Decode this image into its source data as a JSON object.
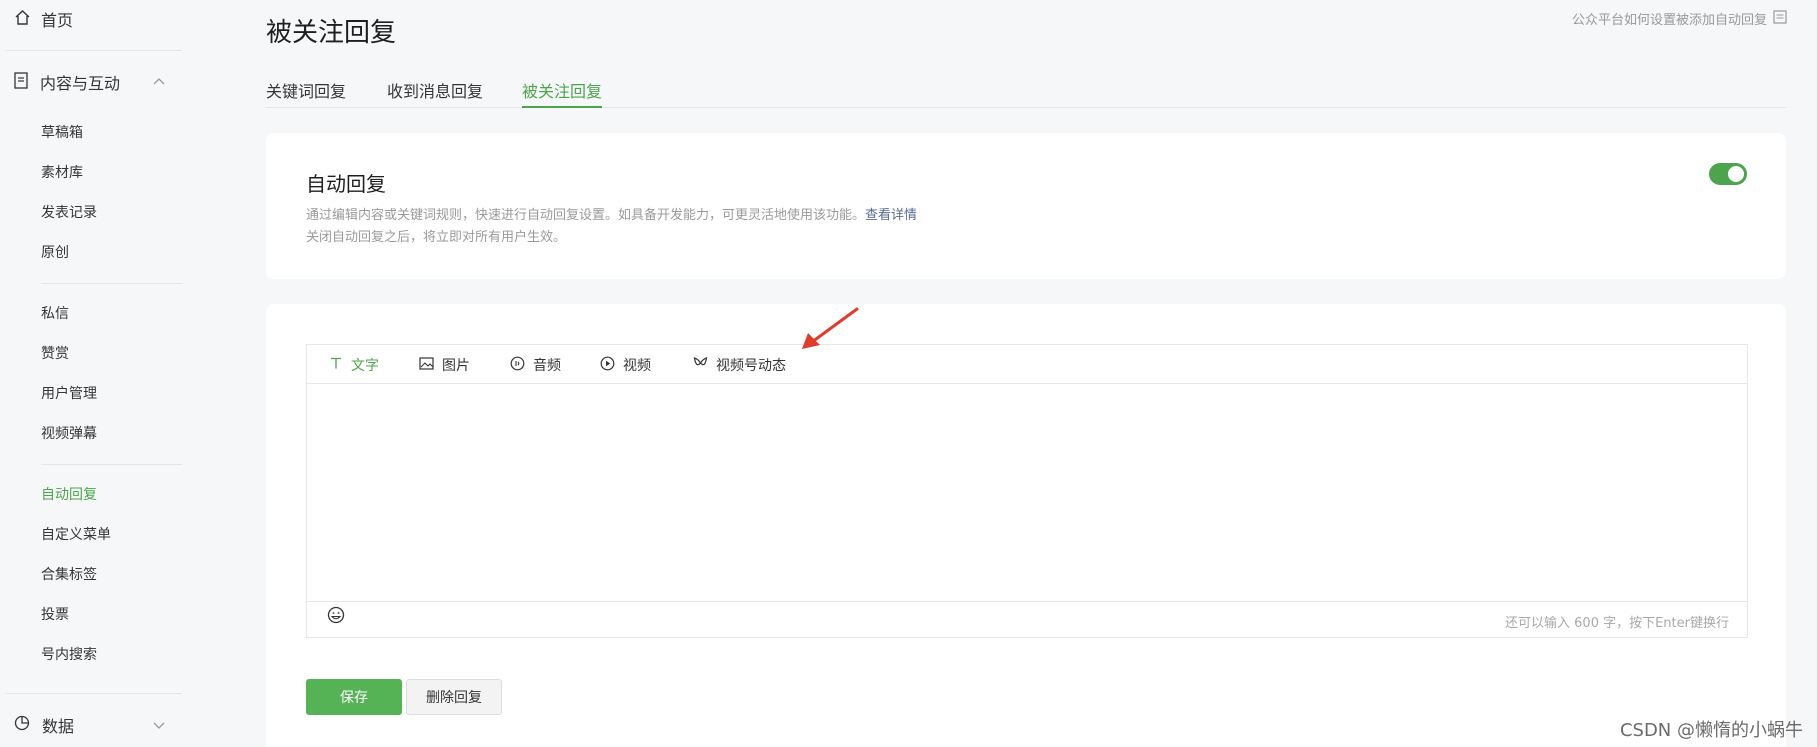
{
  "sidebar": {
    "home": "首页",
    "content_section": "内容与互动",
    "content_items": [
      "草稿箱",
      "素材库",
      "发表记录",
      "原创"
    ],
    "interaction_items": [
      "私信",
      "赞赏",
      "用户管理",
      "视频弹幕"
    ],
    "feature_items": [
      "自动回复",
      "自定义菜单",
      "合集标签",
      "投票",
      "号内搜索"
    ],
    "active_item": "自动回复",
    "data_section": "数据"
  },
  "header": {
    "title": "被关注回复",
    "help_link": "公众平台如何设置被添加自动回复"
  },
  "tabs": [
    {
      "label": "关键词回复",
      "active": false
    },
    {
      "label": "收到消息回复",
      "active": false
    },
    {
      "label": "被关注回复",
      "active": true
    }
  ],
  "auto_reply": {
    "title": "自动回复",
    "desc_line1": "通过编辑内容或关键词规则，快速进行自动回复设置。如具备开发能力，可更灵活地使用该功能。",
    "details_link": "查看详情",
    "desc_line2": "关闭自动回复之后，将立即对所有用户生效。",
    "enabled": true
  },
  "editor": {
    "tabs": [
      {
        "label": "文字",
        "icon": "text-icon",
        "active": true
      },
      {
        "label": "图片",
        "icon": "image-icon",
        "active": false
      },
      {
        "label": "音频",
        "icon": "audio-icon",
        "active": false
      },
      {
        "label": "视频",
        "icon": "video-icon",
        "active": false
      },
      {
        "label": "视频号动态",
        "icon": "channels-icon",
        "active": false
      }
    ],
    "content": "",
    "counter": "还可以输入 600 字，按下Enter键换行"
  },
  "buttons": {
    "save": "保存",
    "delete": "删除回复"
  },
  "watermark": "CSDN @懒惰的小蜗牛",
  "colors": {
    "accent": "#4ca54c",
    "link": "#576b95",
    "annotation_arrow": "#e03c2c"
  }
}
